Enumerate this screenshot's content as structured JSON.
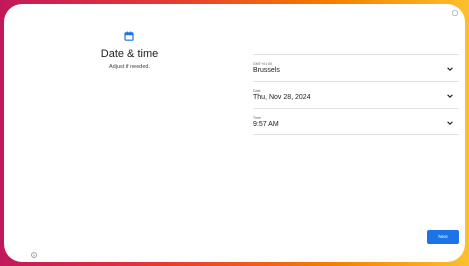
{
  "header": {
    "icon": "calendar-icon",
    "title": "Date & time",
    "subtitle": "Adjust if needed."
  },
  "fields": [
    {
      "label": "GMT+01:00",
      "value": "Brussels",
      "icon": "chevron-down-icon"
    },
    {
      "label": "Date",
      "value": "Thu, Nov 28, 2024",
      "icon": "chevron-down-icon"
    },
    {
      "label": "Time",
      "value": "9:57 AM",
      "icon": "chevron-down-icon"
    }
  ],
  "footer": {
    "next_label": "Next",
    "info_icon": "info-icon"
  },
  "colors": {
    "accent": "#1a73e8",
    "border_gradient": [
      "#c2185b",
      "#e53935",
      "#f57c00",
      "#fbc02d"
    ]
  }
}
